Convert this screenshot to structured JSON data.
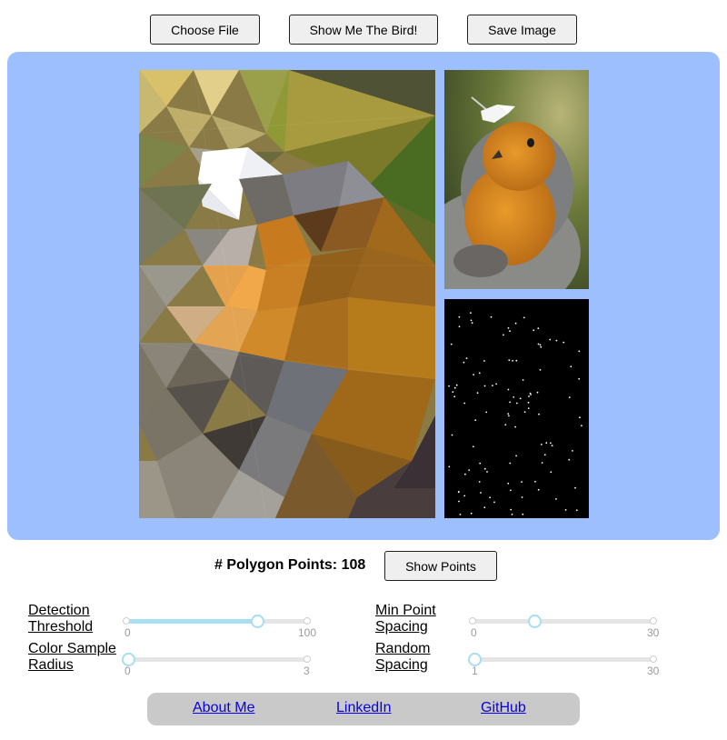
{
  "toolbar": {
    "choose_file_label": "Choose File",
    "show_bird_label": "Show Me The Bird!",
    "save_image_label": "Save Image"
  },
  "panel": {
    "background": "#9dbffd"
  },
  "polygon": {
    "count_label": "# Polygon Points:",
    "count_value": "108",
    "show_points_label": "Show Points"
  },
  "sliders": {
    "detection_threshold": {
      "label_line1": "Detection",
      "label_line2": "Threshold",
      "min": "0",
      "max": "100",
      "value": 72
    },
    "color_sample_radius": {
      "label_line1": "Color Sample",
      "label_line2": "Radius",
      "min": "0",
      "max": "3",
      "value": 0
    },
    "min_point_spacing": {
      "label_line1": "Min Point",
      "label_line2": "Spacing",
      "min": "0",
      "max": "30",
      "value": 10
    },
    "random_spacing": {
      "label_line1": "Random",
      "label_line2": "Spacing",
      "min": "1",
      "max": "30",
      "value": 1
    }
  },
  "footer": {
    "about_label": "About Me",
    "linkedin_label": "LinkedIn",
    "github_label": "GitHub"
  },
  "colors": {
    "slider_accent": "#a7def2",
    "link": "#0b00d9",
    "footer_bg": "#c9c9c9"
  }
}
